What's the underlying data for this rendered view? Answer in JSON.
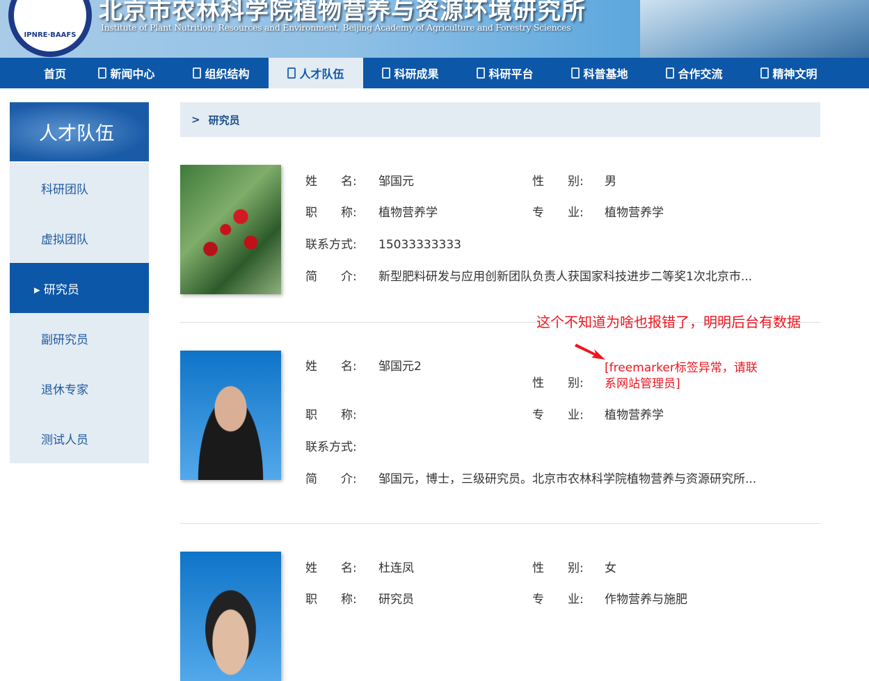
{
  "header": {
    "title_cn": "北京市农林科学院植物营养与资源环境研究所",
    "title_en": "Institute of Plant Nutrition, Resources and Environment, Beijing Academy of Agriculture and Forestry Sciences",
    "logo_text": "IPNRE·BAAFS"
  },
  "nav": [
    "首页",
    "新闻中心",
    "组织结构",
    "人才队伍",
    "科研成果",
    "科研平台",
    "科普基地",
    "合作交流",
    "精神文明"
  ],
  "sidebar": {
    "title": "人才队伍",
    "items": [
      "科研团队",
      "虚拟团队",
      "▸ 研究员",
      "副研究员",
      "退休专家",
      "测试人员"
    ]
  },
  "breadcrumb": {
    "sep": ">",
    "current": "研究员"
  },
  "labels": {
    "name": "姓　　名:",
    "gender": "性　　别:",
    "title": "职　　称:",
    "major": "专　　业:",
    "contact": "联系方式:",
    "intro": "简　　介:"
  },
  "people": [
    {
      "name": "邹国元",
      "gender": "男",
      "title": "植物营养学",
      "major": "植物营养学",
      "contact": "15033333333",
      "intro": "新型肥料研发与应用创新团队负责人获国家科技进步二等奖1次北京市..."
    },
    {
      "name": "邹国元2",
      "gender": "[freemarker标签异常，请联系网站管理员]",
      "gender_l1": "[freemarker标签异常，请联",
      "gender_l2": "系网站管理员]",
      "title": "",
      "major": "植物营养学",
      "contact": "",
      "intro": "邹国元，博士，三级研究员。北京市农林科学院植物营养与资源研究所..."
    },
    {
      "name": "杜连凤",
      "gender": "女",
      "title": "研究员",
      "major": "作物营养与施肥"
    }
  ],
  "annotation": "这个不知道为啥也报错了，明明后台有数据"
}
